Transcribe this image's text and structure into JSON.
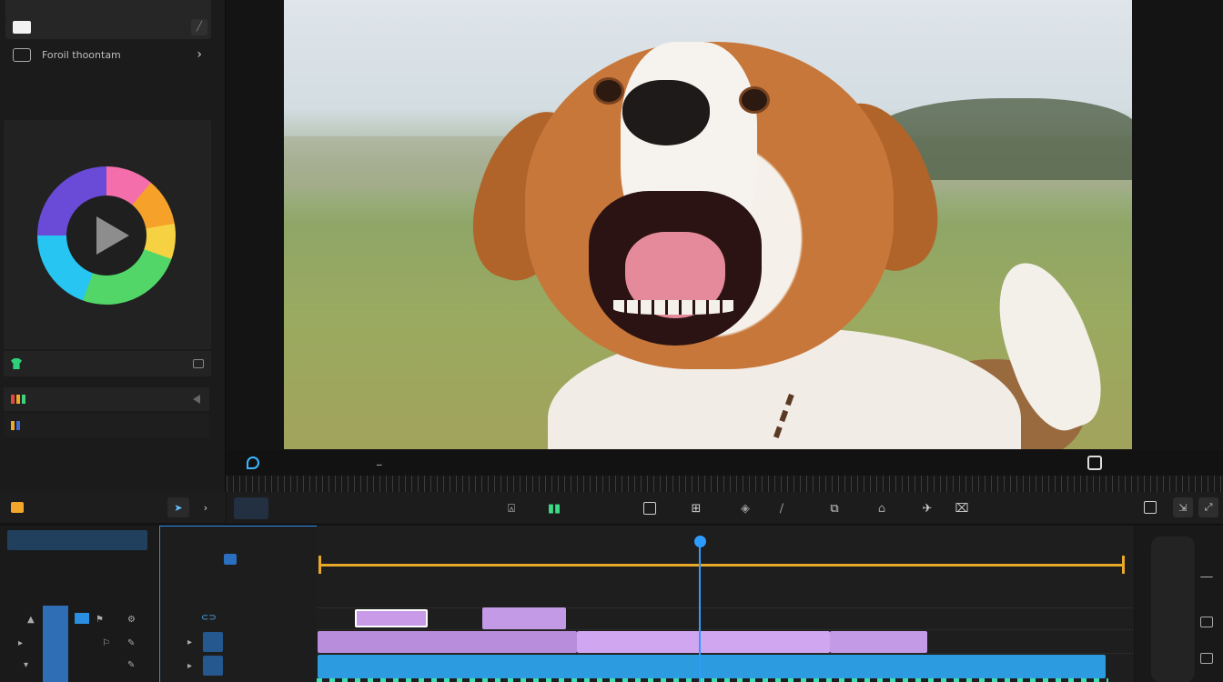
{
  "sidebar": {
    "top_label": "",
    "item1_label": "",
    "item2_label": "Foroil thoontam",
    "player_label": "",
    "green_label": "",
    "layer1_label": "",
    "layer2_label": "",
    "bottom_label": ""
  },
  "preview": {
    "mid_label_cyan": "",
    "mid_label_red": "",
    "mid_label_dash": "_",
    "mid_right_label": ""
  },
  "toolbar": {
    "active_tab_label": ""
  },
  "bottom_left": {
    "header_label": "",
    "sub_label": ""
  },
  "track_header": {
    "title": "",
    "sub": ""
  },
  "timeline": {
    "ticks": []
  },
  "colors": {
    "accent_blue": "#2e9cff",
    "clip_purple": "#c39ae6",
    "clip_blue": "#2c9be0",
    "range_orange": "#e8a92b",
    "green_text": "#39dd85"
  }
}
